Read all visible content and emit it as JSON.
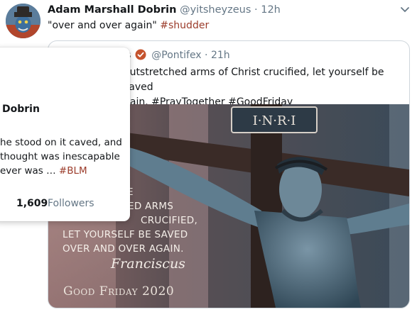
{
  "tweet": {
    "author_name": "Adam Marshall Dobrin",
    "author_handle": "@yitsheyzeus",
    "dot": "·",
    "time": "12h",
    "text": "\"over and over again\"",
    "hashtag": "#shudder"
  },
  "quote": {
    "name_fragment": "s",
    "handle": "@Pontifex",
    "dot": "·",
    "time": "21h",
    "text_line1": "outstretched arms of Christ crucified, let yourself be saved",
    "text_line2": "gain. #PrayTogether #GoodFriday",
    "image": {
      "overlay_lines": [
        "THE",
        "ED ARMS",
        "CRUCIFIED,",
        "LET YOURSELF BE SAVED",
        "OVER AND OVER AGAIN."
      ],
      "signature": "Franciscus",
      "footer": "Good Friday 2020",
      "sign_text": "I·N·R·I"
    }
  },
  "hover_card": {
    "name_fragment": "Dobrin",
    "bio_line1": "he stood on it caved, and",
    "bio_line2": "thought was inescapable",
    "bio_line3": "ever was …",
    "bio_tag": "#BLM",
    "following_fragment": "g",
    "followers_count": "1,609",
    "followers_label": "Followers"
  },
  "colors": {
    "link": "#9b3b2a",
    "muted": "#657786",
    "verified_badge": "#c5532d"
  }
}
